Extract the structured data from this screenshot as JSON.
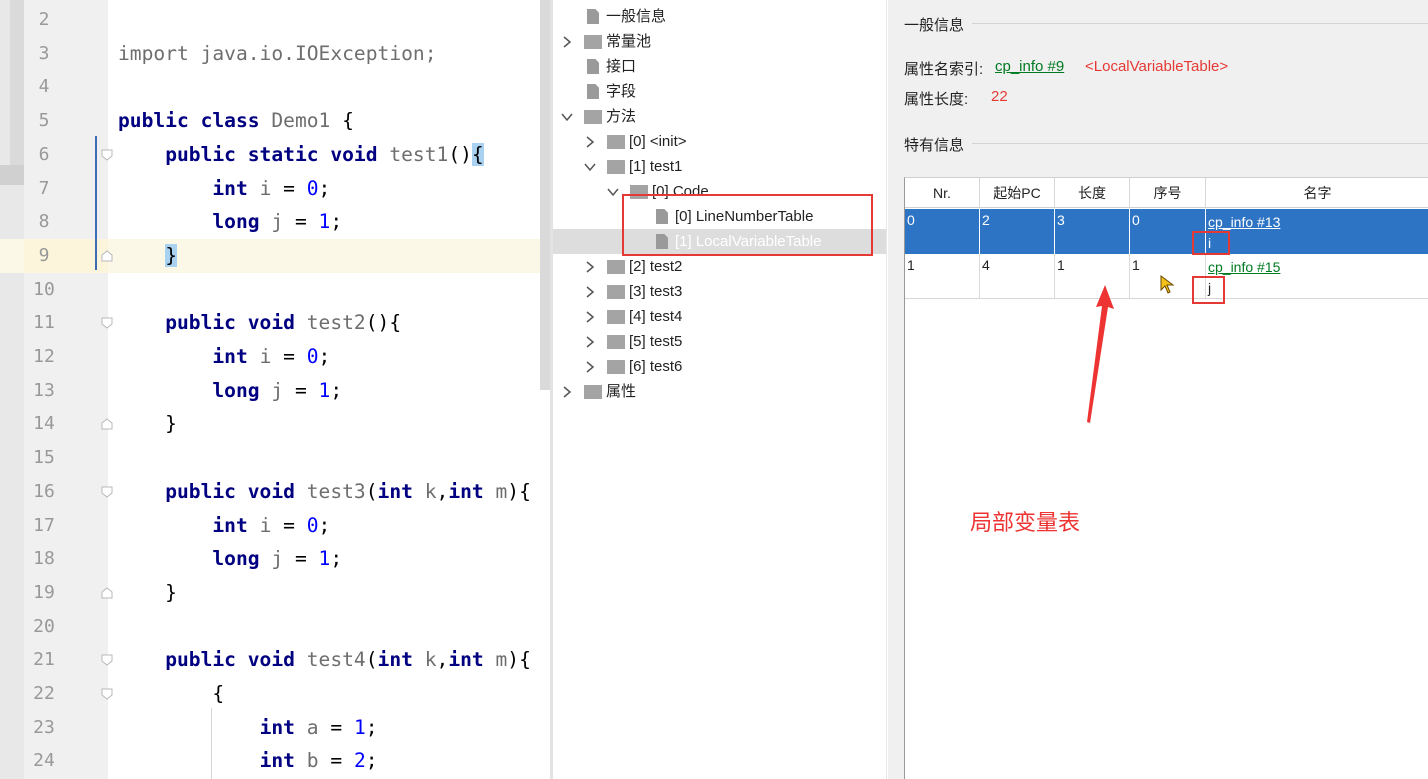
{
  "editor": {
    "lines": [
      {
        "n": "2",
        "tokens": []
      },
      {
        "n": "3",
        "tokens": [
          [
            "id",
            "import java.io.IOException;"
          ]
        ]
      },
      {
        "n": "4",
        "tokens": []
      },
      {
        "n": "5",
        "tokens": [
          [
            "kw",
            "public class "
          ],
          [
            "id",
            "Demo1 "
          ],
          [
            "p",
            "{"
          ]
        ]
      },
      {
        "n": "6",
        "tokens": [
          [
            "p",
            "    "
          ],
          [
            "kw",
            "public static void "
          ],
          [
            "id",
            "test1"
          ],
          [
            "p",
            "()"
          ],
          [
            "hl",
            "{"
          ]
        ]
      },
      {
        "n": "7",
        "tokens": [
          [
            "p",
            "        "
          ],
          [
            "kw",
            "int "
          ],
          [
            "id",
            "i "
          ],
          [
            "p",
            "= "
          ],
          [
            "num",
            "0"
          ],
          [
            "p",
            ";"
          ]
        ]
      },
      {
        "n": "8",
        "tokens": [
          [
            "p",
            "        "
          ],
          [
            "kw",
            "long "
          ],
          [
            "id",
            "j "
          ],
          [
            "p",
            "= "
          ],
          [
            "num",
            "1"
          ],
          [
            "p",
            ";"
          ]
        ]
      },
      {
        "n": "9",
        "tokens": [
          [
            "p",
            "    "
          ],
          [
            "hl",
            "}"
          ]
        ]
      },
      {
        "n": "10",
        "tokens": []
      },
      {
        "n": "11",
        "tokens": [
          [
            "p",
            "    "
          ],
          [
            "kw",
            "public void "
          ],
          [
            "id",
            "test2"
          ],
          [
            "p",
            "(){"
          ]
        ]
      },
      {
        "n": "12",
        "tokens": [
          [
            "p",
            "        "
          ],
          [
            "kw",
            "int "
          ],
          [
            "id",
            "i "
          ],
          [
            "p",
            "= "
          ],
          [
            "num",
            "0"
          ],
          [
            "p",
            ";"
          ]
        ]
      },
      {
        "n": "13",
        "tokens": [
          [
            "p",
            "        "
          ],
          [
            "kw",
            "long "
          ],
          [
            "id",
            "j "
          ],
          [
            "p",
            "= "
          ],
          [
            "num",
            "1"
          ],
          [
            "p",
            ";"
          ]
        ]
      },
      {
        "n": "14",
        "tokens": [
          [
            "p",
            "    }"
          ]
        ]
      },
      {
        "n": "15",
        "tokens": []
      },
      {
        "n": "16",
        "tokens": [
          [
            "p",
            "    "
          ],
          [
            "kw",
            "public void "
          ],
          [
            "id",
            "test3"
          ],
          [
            "p",
            "("
          ],
          [
            "kw",
            "int "
          ],
          [
            "id",
            "k"
          ],
          [
            "p",
            ","
          ],
          [
            "kw",
            "int "
          ],
          [
            "id",
            "m"
          ],
          [
            "p",
            "){"
          ]
        ]
      },
      {
        "n": "17",
        "tokens": [
          [
            "p",
            "        "
          ],
          [
            "kw",
            "int "
          ],
          [
            "id",
            "i "
          ],
          [
            "p",
            "= "
          ],
          [
            "num",
            "0"
          ],
          [
            "p",
            ";"
          ]
        ]
      },
      {
        "n": "18",
        "tokens": [
          [
            "p",
            "        "
          ],
          [
            "kw",
            "long "
          ],
          [
            "id",
            "j "
          ],
          [
            "p",
            "= "
          ],
          [
            "num",
            "1"
          ],
          [
            "p",
            ";"
          ]
        ]
      },
      {
        "n": "19",
        "tokens": [
          [
            "p",
            "    }"
          ]
        ]
      },
      {
        "n": "20",
        "tokens": []
      },
      {
        "n": "21",
        "tokens": [
          [
            "p",
            "    "
          ],
          [
            "kw",
            "public void "
          ],
          [
            "id",
            "test4"
          ],
          [
            "p",
            "("
          ],
          [
            "kw",
            "int "
          ],
          [
            "id",
            "k"
          ],
          [
            "p",
            ","
          ],
          [
            "kw",
            "int "
          ],
          [
            "id",
            "m"
          ],
          [
            "p",
            "){"
          ]
        ]
      },
      {
        "n": "22",
        "tokens": [
          [
            "p",
            "        {"
          ]
        ]
      },
      {
        "n": "23",
        "tokens": [
          [
            "p",
            "            "
          ],
          [
            "kw",
            "int "
          ],
          [
            "id",
            "a "
          ],
          [
            "p",
            "= "
          ],
          [
            "num",
            "1"
          ],
          [
            "p",
            ";"
          ]
        ]
      },
      {
        "n": "24",
        "tokens": [
          [
            "p",
            "            "
          ],
          [
            "kw",
            "int "
          ],
          [
            "id",
            "b "
          ],
          [
            "p",
            "= "
          ],
          [
            "num",
            "2"
          ],
          [
            "p",
            ";"
          ]
        ]
      }
    ]
  },
  "tree": {
    "nodes": [
      {
        "label": "一般信息",
        "icon": "file-icon",
        "arrow": ""
      },
      {
        "label": "常量池",
        "icon": "folder-icon",
        "arrow": ">"
      },
      {
        "label": "接口",
        "icon": "file-icon",
        "arrow": ""
      },
      {
        "label": "字段",
        "icon": "file-icon",
        "arrow": ""
      },
      {
        "label": "方法",
        "icon": "folder-icon",
        "arrow": "v"
      },
      {
        "label": "[0] <init>",
        "icon": "folder-icon",
        "arrow": ">"
      },
      {
        "label": "[1] test1",
        "icon": "folder-icon",
        "arrow": "v"
      },
      {
        "label": "[0] Code",
        "icon": "folder-icon",
        "arrow": "v"
      },
      {
        "label": "[0] LineNumberTable",
        "icon": "file-icon",
        "arrow": ""
      },
      {
        "label": "[1] LocalVariableTable",
        "icon": "file-icon",
        "arrow": "",
        "selected": true
      },
      {
        "label": "[2] test2",
        "icon": "folder-icon",
        "arrow": ">"
      },
      {
        "label": "[3] test3",
        "icon": "folder-icon",
        "arrow": ">"
      },
      {
        "label": "[4] test4",
        "icon": "folder-icon",
        "arrow": ">"
      },
      {
        "label": "[5] test5",
        "icon": "folder-icon",
        "arrow": ">"
      },
      {
        "label": "[6] test6",
        "icon": "folder-icon",
        "arrow": ">"
      },
      {
        "label": "属性",
        "icon": "folder-icon",
        "arrow": ">"
      }
    ]
  },
  "details": {
    "general_title": "一般信息",
    "attr_name_index_label": "属性名索引:",
    "attr_name_index_link": "cp_info #9",
    "attr_name_index_value": "<LocalVariableTable>",
    "attr_length_label": "属性长度:",
    "attr_length_value": "22",
    "specific_title": "特有信息",
    "table": {
      "columns": [
        "Nr.",
        "起始PC",
        "长度",
        "序号",
        "名字"
      ],
      "rows": [
        {
          "nr": "0",
          "start_pc": "2",
          "length": "3",
          "index": "0",
          "name_link": "cp_info #13",
          "name": "i",
          "selected": true
        },
        {
          "nr": "1",
          "start_pc": "4",
          "length": "1",
          "index": "1",
          "name_link": "cp_info #15",
          "name": "j",
          "selected": false
        }
      ]
    }
  },
  "annotation": {
    "text": "局部变量表",
    "color": "#ee3333"
  }
}
